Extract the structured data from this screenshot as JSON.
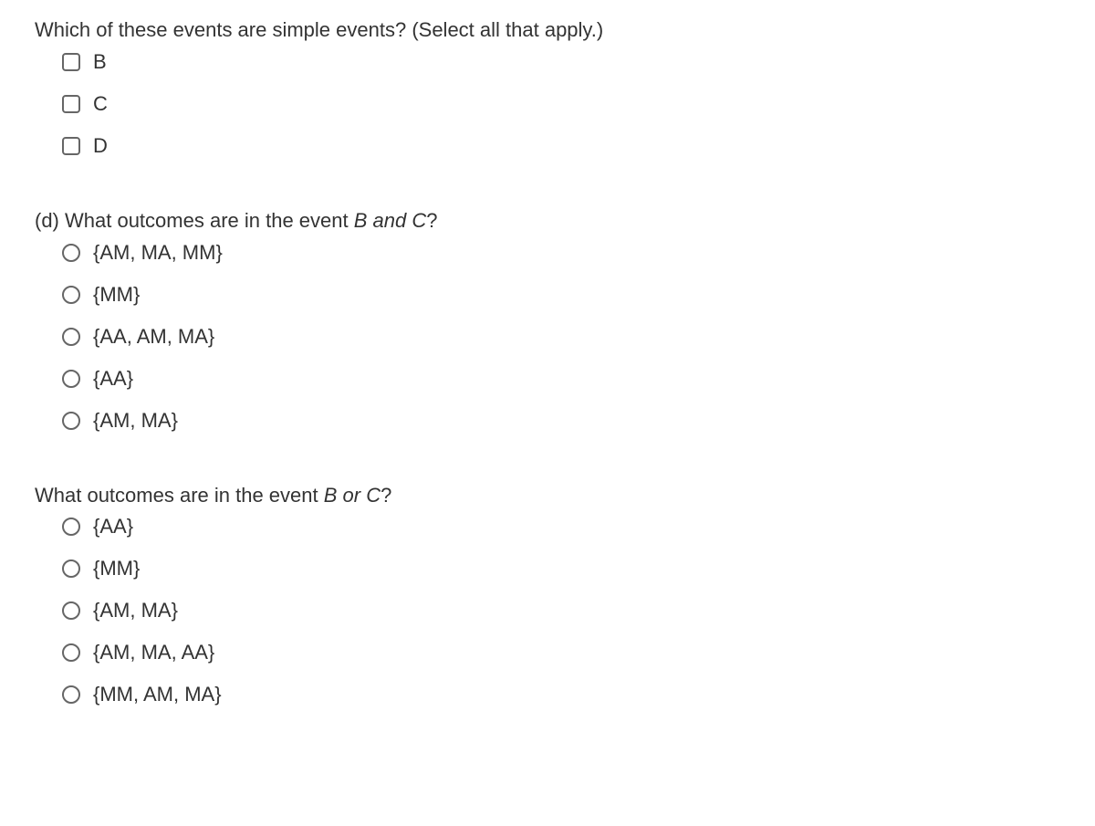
{
  "q1": {
    "prompt": "Which of these events are simple events? (Select all that apply.)",
    "type": "checkbox",
    "options": [
      "B",
      "C",
      "D"
    ]
  },
  "q2": {
    "prompt_prefix": "(d) What outcomes are in the event ",
    "prompt_italic": "B and C",
    "prompt_suffix": "?",
    "type": "radio",
    "options": [
      "{AM, MA, MM}",
      "{MM}",
      "{AA, AM, MA}",
      "{AA}",
      "{AM, MA}"
    ]
  },
  "q3": {
    "prompt_prefix": "What outcomes are in the event ",
    "prompt_italic": "B or C",
    "prompt_suffix": "?",
    "type": "radio",
    "options": [
      "{AA}",
      "{MM}",
      "{AM, MA}",
      "{AM, MA, AA}",
      "{MM, AM, MA}"
    ]
  }
}
